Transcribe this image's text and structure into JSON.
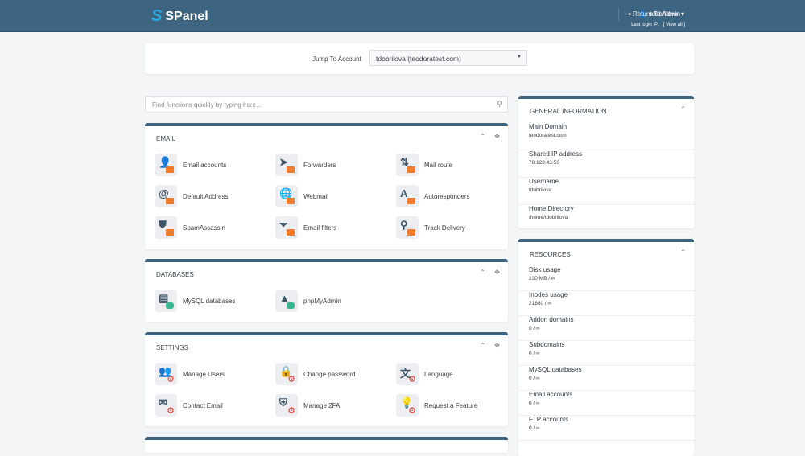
{
  "header": {
    "logo": "SPanel",
    "user": "tdobrilova",
    "return": "Return To Admin",
    "last_login_label": "Last login IP:",
    "view_all": "[ View all ]"
  },
  "jump": {
    "label": "Jump To Account",
    "value": "tdobrilova (teodoratest.com)"
  },
  "search": {
    "placeholder": "Find functions quickly by typing here..."
  },
  "email": {
    "title": "EMAIL",
    "items": [
      {
        "label": "Email accounts",
        "icon": "user-icon",
        "g": "👤"
      },
      {
        "label": "Forwarders",
        "icon": "send-icon",
        "g": "➤"
      },
      {
        "label": "Mail route",
        "icon": "route-icon",
        "g": "⇅"
      },
      {
        "label": "Default Address",
        "icon": "at-icon",
        "g": "@"
      },
      {
        "label": "Webmail",
        "icon": "globe-icon",
        "g": "🌐"
      },
      {
        "label": "Autoresponders",
        "icon": "a-icon",
        "g": "A"
      },
      {
        "label": "SpamAssassin",
        "icon": "shield-icon",
        "g": "⛊"
      },
      {
        "label": "Email filters",
        "icon": "filter-icon",
        "g": "⏷"
      },
      {
        "label": "Track Delivery",
        "icon": "magnifier-icon",
        "g": "⚲"
      }
    ]
  },
  "databases": {
    "title": "DATABASES",
    "items": [
      {
        "label": "MySQL databases",
        "icon": "server-icon",
        "g": "▤"
      },
      {
        "label": "phpMyAdmin",
        "icon": "admin-icon",
        "g": "▲"
      }
    ]
  },
  "settings": {
    "title": "SETTINGS",
    "items": [
      {
        "label": "Manage Users",
        "icon": "users-icon",
        "g": "👥"
      },
      {
        "label": "Change password",
        "icon": "lock-icon",
        "g": "🔒"
      },
      {
        "label": "Language",
        "icon": "language-icon",
        "g": "文"
      },
      {
        "label": "Contact Email",
        "icon": "envelope-icon",
        "g": "✉"
      },
      {
        "label": "Manage 2FA",
        "icon": "twofa-icon",
        "g": "⛨"
      },
      {
        "label": "Request a Feature",
        "icon": "bulb-icon",
        "g": "💡"
      }
    ]
  },
  "general": {
    "title": "GENERAL INFORMATION",
    "rows": [
      {
        "k": "Main Domain",
        "v": "teodoratest.com"
      },
      {
        "k": "Shared IP address",
        "v": "78.128.43.50"
      },
      {
        "k": "Username",
        "v": "tdobrilova"
      },
      {
        "k": "Home Directory",
        "v": "/home/tdobrilova"
      }
    ]
  },
  "resources": {
    "title": "RESOURCES",
    "rows": [
      {
        "k": "Disk usage",
        "v": "230 MB / ∞"
      },
      {
        "k": "Inodes usage",
        "v": "21880 / ∞"
      },
      {
        "k": "Addon domains",
        "v": "0 / ∞"
      },
      {
        "k": "Subdomains",
        "v": "0 / ∞"
      },
      {
        "k": "MySQL databases",
        "v": "0 / ∞"
      },
      {
        "k": "Email accounts",
        "v": "0 / ∞"
      },
      {
        "k": "FTP accounts",
        "v": "0 / ∞"
      }
    ]
  }
}
